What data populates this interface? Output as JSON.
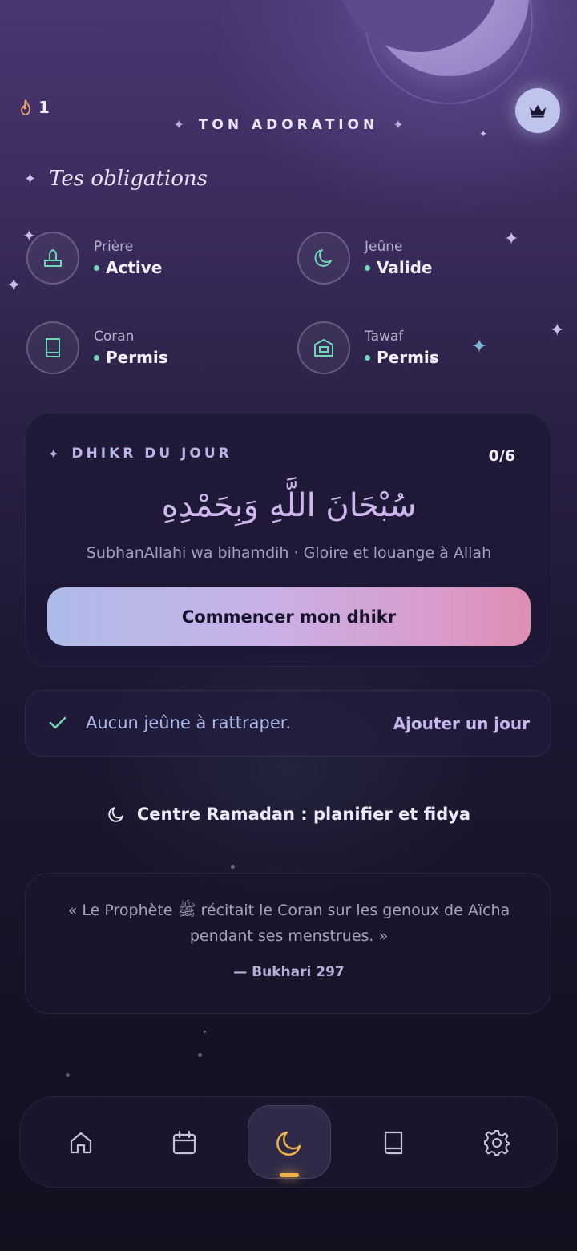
{
  "colors": {
    "accent": "#cfb7ee",
    "mint": "#6fd6b6",
    "gold": "#f0b34a",
    "button_gradient": [
      "#aebbe8",
      "#c8b1e8",
      "#df8db3"
    ]
  },
  "header": {
    "streak_count": "1",
    "streak_icon": "flame-icon",
    "crown_icon": "crown-icon",
    "title": "TON ADORATION"
  },
  "obligations": {
    "title": "Tes obligations",
    "items": [
      {
        "label": "Prière",
        "status": "Active",
        "icon": "prayer-mat-icon"
      },
      {
        "label": "Jeûne",
        "status": "Valide",
        "icon": "moon-icon"
      },
      {
        "label": "Coran",
        "status": "Permis",
        "icon": "book-icon"
      },
      {
        "label": "Tawaf",
        "status": "Permis",
        "icon": "kaaba-icon"
      }
    ]
  },
  "dhikr": {
    "title": "DHIKR DU JOUR",
    "count": "0/6",
    "arabic": "سُبْحَانَ اللَّهِ وَبِحَمْدِهِ",
    "transliteration": "SubhanAllahi wa bihamdih · Gloire et louange à Allah",
    "button_label": "Commencer mon dhikr"
  },
  "fasting": {
    "status_text": "Aucun jeûne à rattraper.",
    "add_label": "Ajouter un jour"
  },
  "ramadan": {
    "label": "Centre Ramadan : planifier et fidya"
  },
  "quote": {
    "text": "« Le Prophète ﷺ récitait le Coran sur les genoux de Aïcha pendant ses menstrues. »",
    "source": "— Bukhari 297"
  },
  "nav": {
    "items": [
      {
        "icon": "home-icon"
      },
      {
        "icon": "calendar-icon"
      },
      {
        "icon": "moon-icon",
        "active": true
      },
      {
        "icon": "book-icon"
      },
      {
        "icon": "settings-gear-icon"
      }
    ]
  }
}
